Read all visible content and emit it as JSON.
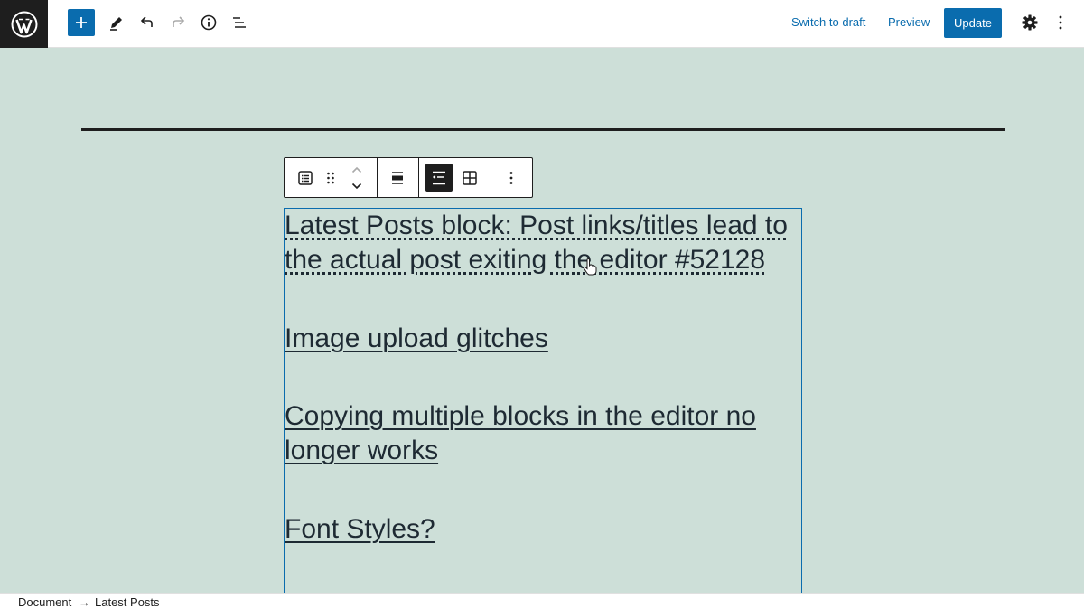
{
  "header": {
    "switch_to_draft": "Switch to draft",
    "preview": "Preview",
    "update": "Update",
    "icons": [
      "wordpress-icon",
      "plus-icon",
      "pencil-icon",
      "undo-icon",
      "redo-icon",
      "info-icon",
      "list-view-icon",
      "gear-icon",
      "more-vertical-icon"
    ]
  },
  "block_toolbar": {
    "icons": [
      "latest-posts-icon",
      "drag-handle-icon",
      "move-up-icon",
      "move-down-icon",
      "align-icon",
      "list-view-layout-icon",
      "grid-view-icon",
      "more-options-icon"
    ],
    "active": "list-view-layout-icon"
  },
  "posts": [
    {
      "line1": "Latest Posts block: Post links/titles lead to",
      "line2": "the actual post exiting the editor #52128"
    },
    {
      "line1": "Image upload glitches",
      "line2": ""
    },
    {
      "line1": "Copying multiple blocks in the editor no",
      "line2": "longer works"
    },
    {
      "line1": "Font Styles?",
      "line2": ""
    }
  ],
  "breadcrumb": {
    "items": [
      "Document",
      "Latest Posts"
    ],
    "separator": "→"
  },
  "colors": {
    "accent": "#0a6cae",
    "canvas_background": "#cddfd8",
    "dark": "#1e1e1e"
  }
}
